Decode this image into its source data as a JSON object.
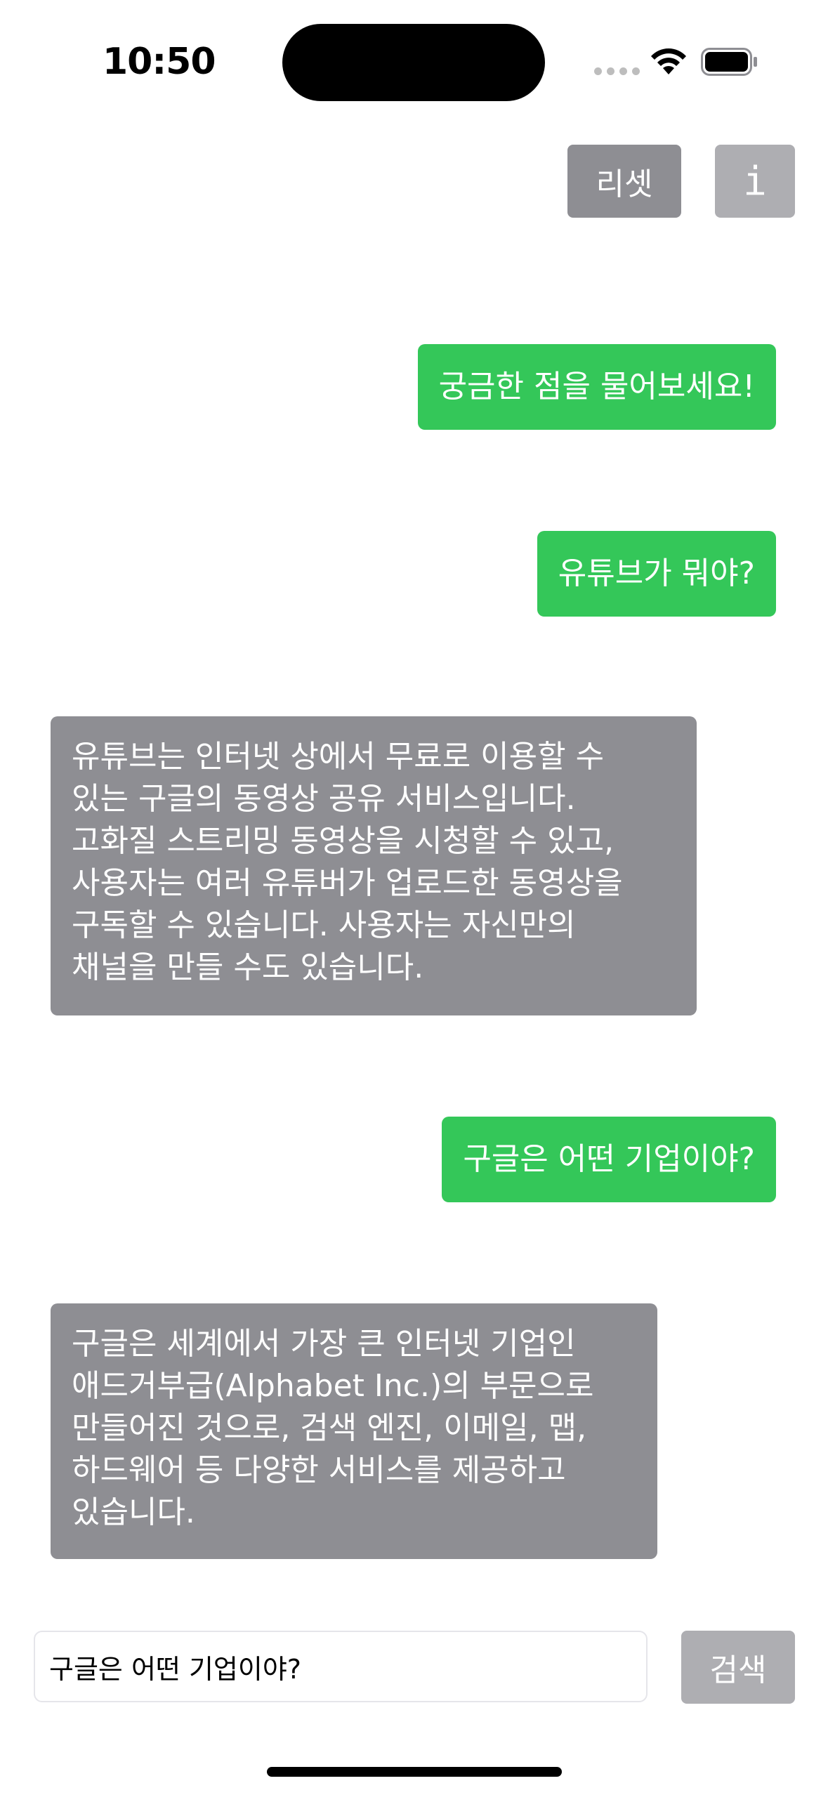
{
  "status_bar": {
    "time": "10:50"
  },
  "toolbar": {
    "reset_label": "리셋",
    "info_label": "i"
  },
  "messages": [
    {
      "role": "user",
      "text": "궁금한 점을 물어보세요!"
    },
    {
      "role": "user",
      "text": "유튜브가 뭐야?"
    },
    {
      "role": "assistant",
      "lines": [
        "유튜브는 인터넷 상에서 무료로 이용할 수",
        "있는 구글의 동영상 공유 서비스입니다.",
        "고화질 스트리밍 동영상을 시청할 수 있고,",
        "사용자는 여러 유튜버가 업로드한 동영상을",
        "구독할 수 있습니다. 사용자는 자신만의",
        "채널을 만들 수도 있습니다."
      ]
    },
    {
      "role": "user",
      "text": "구글은 어떤 기업이야?"
    },
    {
      "role": "assistant",
      "lines": [
        "구글은 세계에서 가장 큰 인터넷 기업인",
        "애드거부급(Alphabet Inc.)의 부문으로",
        "만들어진 것으로, 검색 엔진, 이메일, 맵,",
        "하드웨어 등 다양한 서비스를 제공하고",
        "있습니다."
      ]
    }
  ],
  "input": {
    "value": "구글은 어떤 기업이야?"
  },
  "search_button": {
    "label": "검색"
  },
  "colors": {
    "user_bubble": "#34c759",
    "assistant_bubble": "#8e8e93",
    "button_gray": "#8e8e93",
    "button_light_gray": "#aeaeb2"
  }
}
